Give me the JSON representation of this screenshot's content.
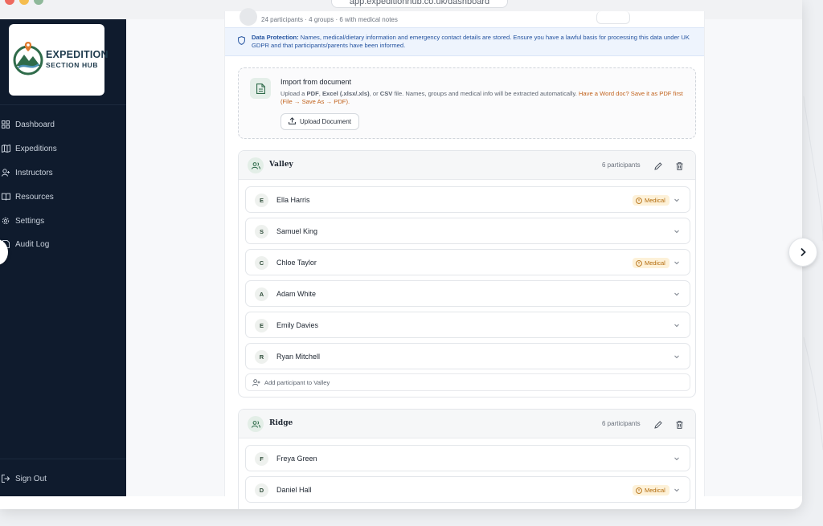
{
  "browser": {
    "url": "app.expeditionhub.co.uk/dashboard"
  },
  "brand": {
    "line1": "EXPEDITION",
    "line2": "SECTION HUB"
  },
  "sidebar": {
    "items": [
      {
        "label": "Dashboard",
        "icon": "grid-icon"
      },
      {
        "label": "Expeditions",
        "icon": "map-icon"
      },
      {
        "label": "Instructors",
        "icon": "user-plus-icon"
      },
      {
        "label": "Resources",
        "icon": "book-icon"
      },
      {
        "label": "Settings",
        "icon": "gear-icon"
      },
      {
        "label": "Audit Log",
        "icon": "file-icon"
      }
    ],
    "sign_out": "Sign Out"
  },
  "header": {
    "meta": "24 participants · 4 groups · 6 with medical notes"
  },
  "data_protection": {
    "title": "Data Protection:",
    "text": "Names, medical/dietary information and emergency contact details are stored. Ensure you have a lawful basis for processing this data under UK GDPR and that participants/parents have been informed."
  },
  "import": {
    "title": "Import from document",
    "desc_prefix": "Upload a ",
    "pdf": "PDF",
    "excel": "Excel (.xlsx/.xls)",
    "or": ", or ",
    "csv": "CSV",
    "desc_suffix": " file. Names, groups and medical info will be extracted automatically.",
    "warn": "Have a Word doc? Save it as PDF first (File → Save As → PDF).",
    "button": "Upload Document"
  },
  "groups": [
    {
      "name": "Valley",
      "count": "6 participants",
      "add_label": "Add participant to Valley",
      "participants": [
        {
          "initial": "E",
          "name": "Ella Harris",
          "badge": "Medical"
        },
        {
          "initial": "S",
          "name": "Samuel King",
          "badge": ""
        },
        {
          "initial": "C",
          "name": "Chloe Taylor",
          "badge": "Medical"
        },
        {
          "initial": "A",
          "name": "Adam White",
          "badge": ""
        },
        {
          "initial": "E",
          "name": "Emily Davies",
          "badge": ""
        },
        {
          "initial": "R",
          "name": "Ryan Mitchell",
          "badge": ""
        }
      ]
    },
    {
      "name": "Ridge",
      "count": "6 participants",
      "participants": [
        {
          "initial": "F",
          "name": "Freya Green",
          "badge": ""
        },
        {
          "initial": "D",
          "name": "Daniel Hall",
          "badge": "Medical"
        }
      ]
    }
  ],
  "colors": {
    "sidebar_bg": "#0f1b2d",
    "accent_green": "#2f6b4a",
    "medical_badge": "#fdf1d8",
    "info_blue": "#2554a0"
  }
}
